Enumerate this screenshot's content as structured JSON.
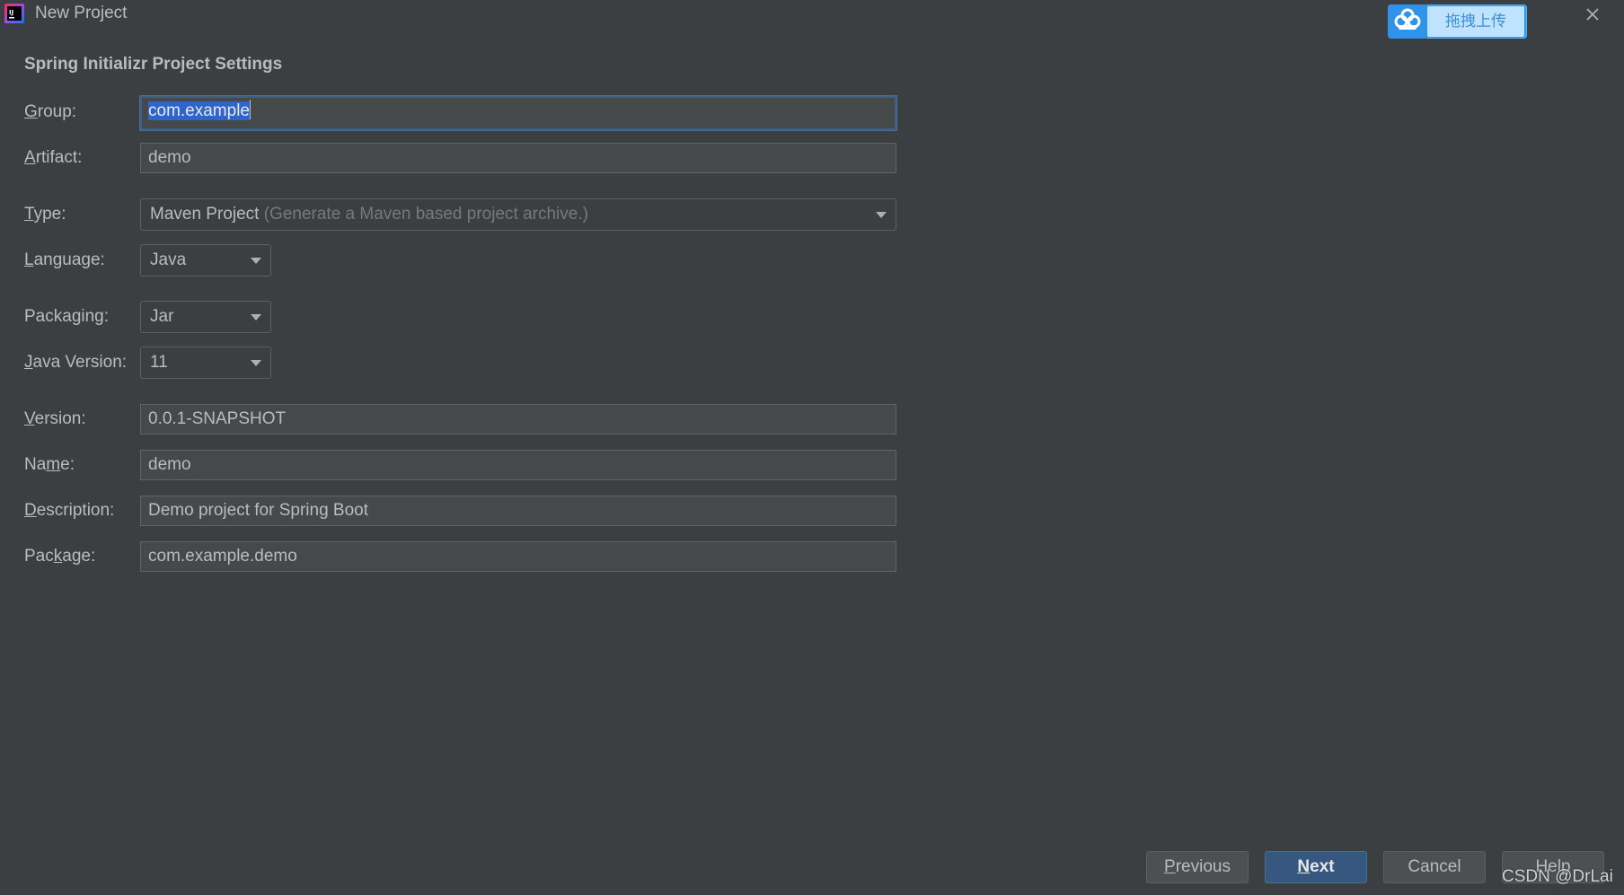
{
  "window": {
    "title": "New Project",
    "close_icon": "close-icon"
  },
  "upload_widget": {
    "icon": "cloud-icon",
    "label": "拖拽上传"
  },
  "form": {
    "heading": "Spring Initializr Project Settings",
    "group": {
      "label_pre": "",
      "label_mn": "G",
      "label_post": "roup:",
      "value": "com.example"
    },
    "artifact": {
      "label_pre": "",
      "label_mn": "A",
      "label_post": "rtifact:",
      "value": "demo"
    },
    "type": {
      "label_pre": "",
      "label_mn": "T",
      "label_post": "ype:",
      "value": "Maven Project",
      "hint": "(Generate a Maven based project archive.)"
    },
    "language": {
      "label_pre": "",
      "label_mn": "L",
      "label_post": "anguage:",
      "value": "Java"
    },
    "packaging": {
      "label_pre": "Packa",
      "label_mn": "g",
      "label_post": "ing:",
      "value": "Jar"
    },
    "java_version": {
      "label_pre": "",
      "label_mn": "J",
      "label_post": "ava Version:",
      "value": "11"
    },
    "version": {
      "label_pre": "",
      "label_mn": "V",
      "label_post": "ersion:",
      "value": "0.0.1-SNAPSHOT"
    },
    "name": {
      "label_pre": "Na",
      "label_mn": "m",
      "label_post": "e:",
      "value": "demo"
    },
    "description": {
      "label_pre": "",
      "label_mn": "D",
      "label_post": "escription:",
      "value": "Demo project for Spring Boot"
    },
    "package": {
      "label_pre": "Pac",
      "label_mn": "k",
      "label_post": "age:",
      "value": "com.example.demo"
    }
  },
  "buttons": {
    "previous": {
      "pre": "",
      "mn": "P",
      "post": "revious"
    },
    "next": {
      "pre": "",
      "mn": "N",
      "post": "ext"
    },
    "cancel": "Cancel",
    "help": "Help"
  },
  "watermark": "CSDN @DrLai",
  "colors": {
    "background": "#3c3f41",
    "field_bg": "#45494a",
    "primary_button": "#365880",
    "selection": "#2f65ca",
    "upload_blue": "#2a9af0"
  }
}
